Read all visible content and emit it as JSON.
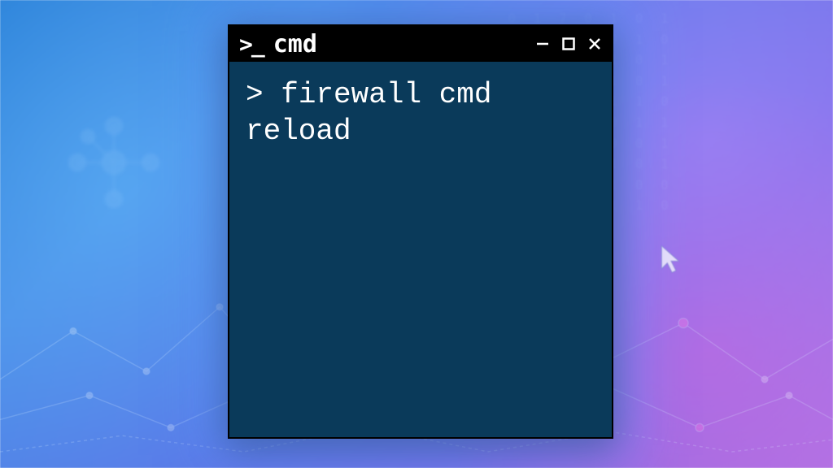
{
  "window": {
    "icon_glyph": ">_",
    "title": "cmd",
    "controls": {
      "minimize": "minimize",
      "maximize": "maximize",
      "close": "close"
    }
  },
  "terminal": {
    "prompt": "> ",
    "command": "firewall cmd reload",
    "bg_color": "#0a3a5a",
    "fg_color": "#ffffff"
  }
}
